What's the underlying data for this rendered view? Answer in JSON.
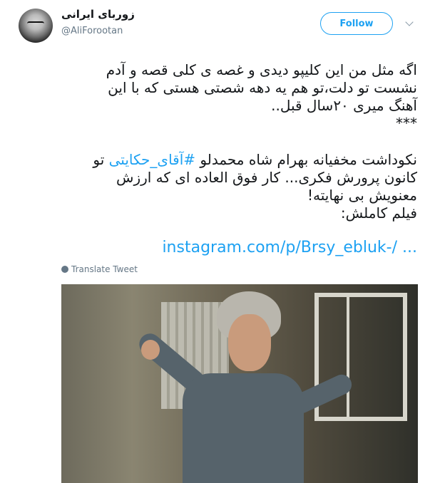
{
  "user": {
    "name": "زوربای ایرانی",
    "handle": "@AliForootan"
  },
  "follow_label": "Follow",
  "tweet": {
    "paragraph1": [
      "اگه مثل من این کلیپو دیدی و غصه ی کلی قصه و آدم",
      "نشست تو دلت،تو هم یه دهه شصتی هستی که با این",
      "آهنگ میری ۲۰سال قبل..",
      "***"
    ],
    "paragraph2_line1_before": "نکوداشت مخفیانه بهرام شاه محمدلو ",
    "hashtag": "#آقای_حکایتی",
    "paragraph2_line1_after": " تو",
    "paragraph2_rest": [
      "کانون پرورش فکری... کار فوق العاده ای که ارزش",
      "معنویش بی نهایته!",
      "فیلم کاملش:"
    ],
    "link": "instagram.com/p/Brsy_ebluk-/ ..."
  },
  "translate_label": "Translate Tweet",
  "icons": {
    "globe": "globe-icon",
    "caret": "chevron-down-icon"
  },
  "colors": {
    "accent": "#1da1f2",
    "secondary_text": "#657786"
  }
}
